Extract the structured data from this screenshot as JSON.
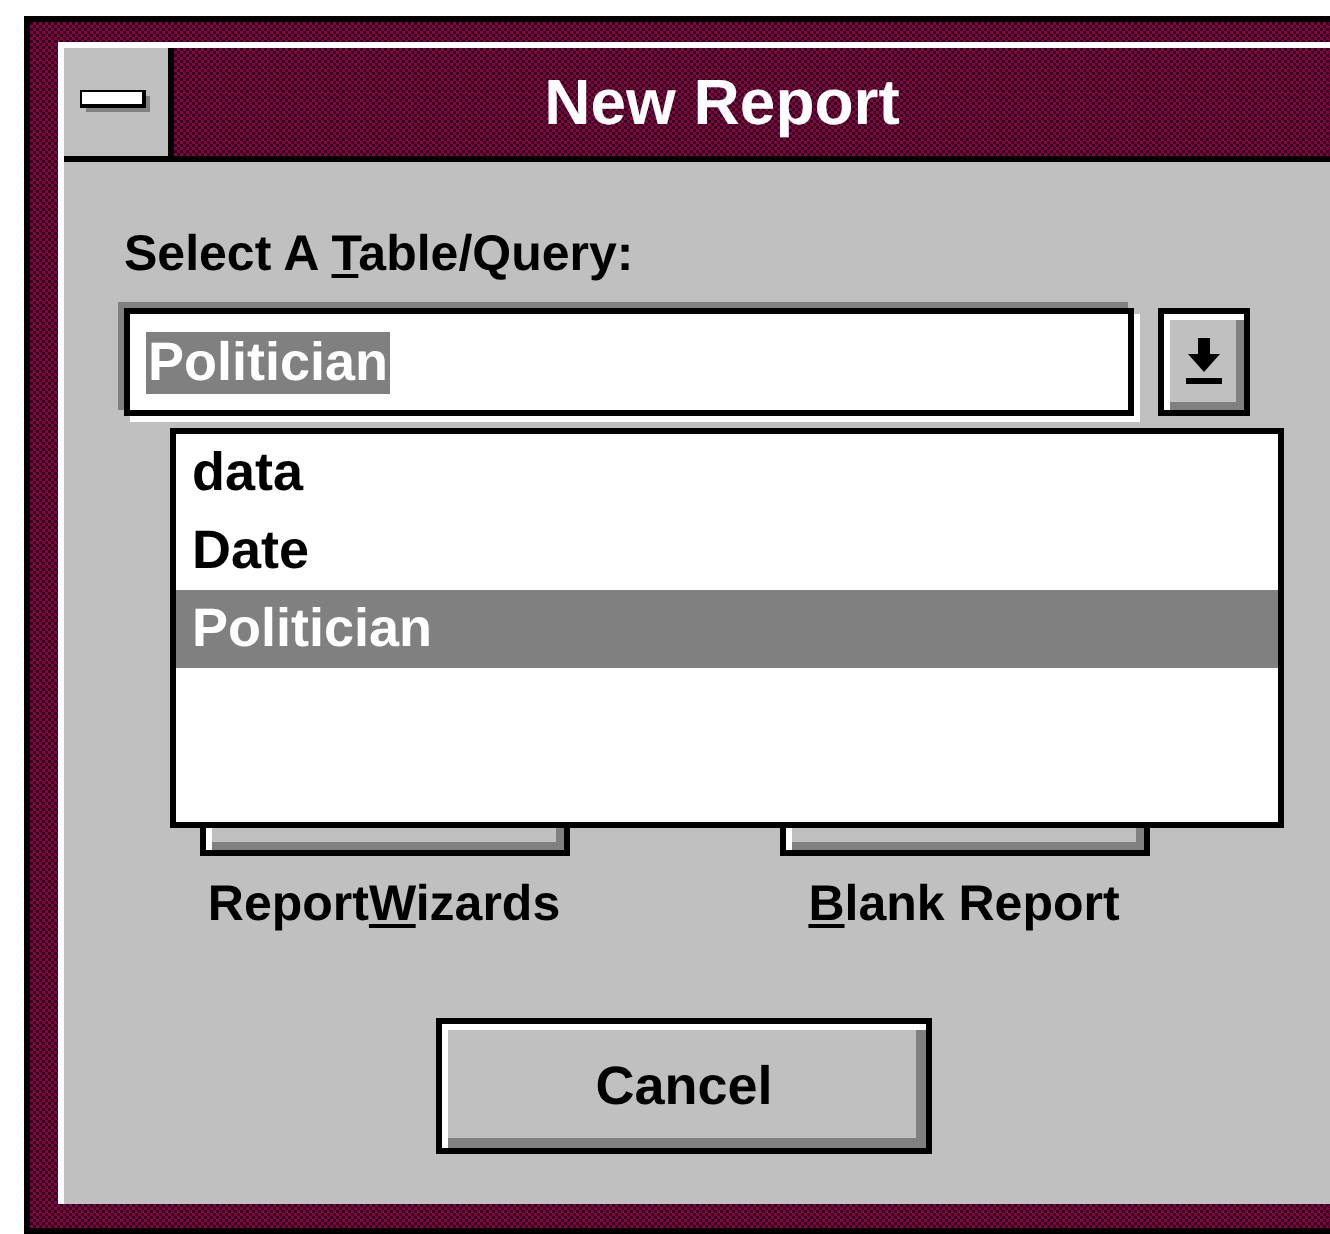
{
  "window": {
    "title": "New Report"
  },
  "table_label": {
    "before": "Select A ",
    "key": "T",
    "after": "able/Query:"
  },
  "combo": {
    "value": "Politician",
    "highlighted": true,
    "open": true
  },
  "options": [
    {
      "label": "data",
      "selected": false
    },
    {
      "label": "Date",
      "selected": false
    },
    {
      "label": "Politician",
      "selected": true
    }
  ],
  "picture_buttons": [
    {
      "before": "Report",
      "key": "W",
      "after": "izards"
    },
    {
      "key": "B",
      "after": "lank Report"
    }
  ],
  "buttons": [
    "Cancel"
  ]
}
